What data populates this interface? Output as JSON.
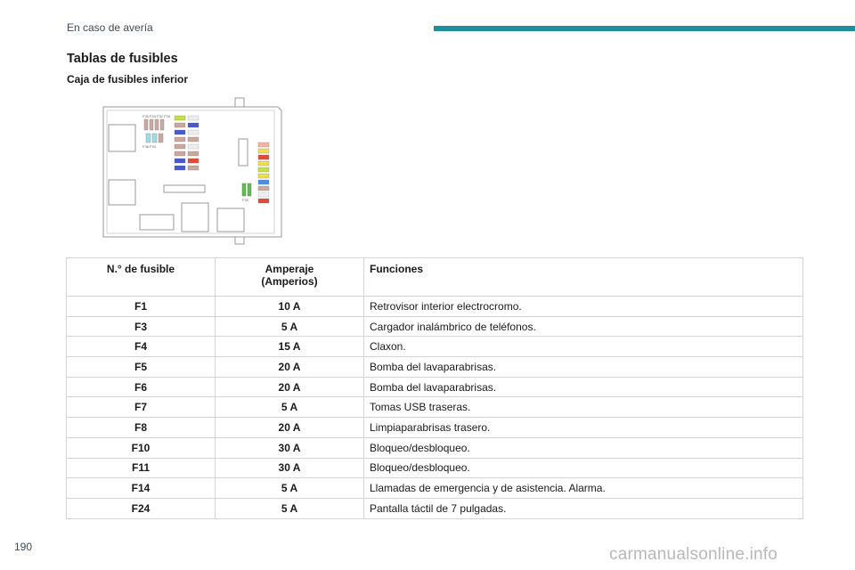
{
  "header": {
    "section": "En caso de avería",
    "accent_color": "#1f8f9c"
  },
  "title": "Tablas de fusibles",
  "subtitle": "Caja de fusibles inferior",
  "diagram": {
    "description_icon": "fuse-box-diagram",
    "labels": [
      "F35",
      "F34",
      "F32",
      "F33",
      "F36"
    ]
  },
  "table": {
    "headers": {
      "col1": "N.° de fusible",
      "col2_line1": "Amperaje",
      "col2_line2": "(Amperios)",
      "col3": "Funciones"
    },
    "rows": [
      {
        "fuse": "F1",
        "amp": "10 A",
        "func": "Retrovisor interior electrocromo."
      },
      {
        "fuse": "F3",
        "amp": "5 A",
        "func": "Cargador inalámbrico de teléfonos."
      },
      {
        "fuse": "F4",
        "amp": "15 A",
        "func": "Claxon."
      },
      {
        "fuse": "F5",
        "amp": "20 A",
        "func": "Bomba del lavaparabrisas."
      },
      {
        "fuse": "F6",
        "amp": "20 A",
        "func": "Bomba del lavaparabrisas."
      },
      {
        "fuse": "F7",
        "amp": "5 A",
        "func": "Tomas USB traseras."
      },
      {
        "fuse": "F8",
        "amp": "20 A",
        "func": "Limpiaparabrisas trasero."
      },
      {
        "fuse": "F10",
        "amp": "30 A",
        "func": "Bloqueo/desbloqueo."
      },
      {
        "fuse": "F11",
        "amp": "30 A",
        "func": "Bloqueo/desbloqueo."
      },
      {
        "fuse": "F14",
        "amp": "5 A",
        "func": "Llamadas de emergencia y de asistencia. Alarma."
      },
      {
        "fuse": "F24",
        "amp": "5 A",
        "func": "Pantalla táctil de 7 pulgadas."
      }
    ]
  },
  "page_number": "190",
  "watermark": "carmanualsonline.info"
}
